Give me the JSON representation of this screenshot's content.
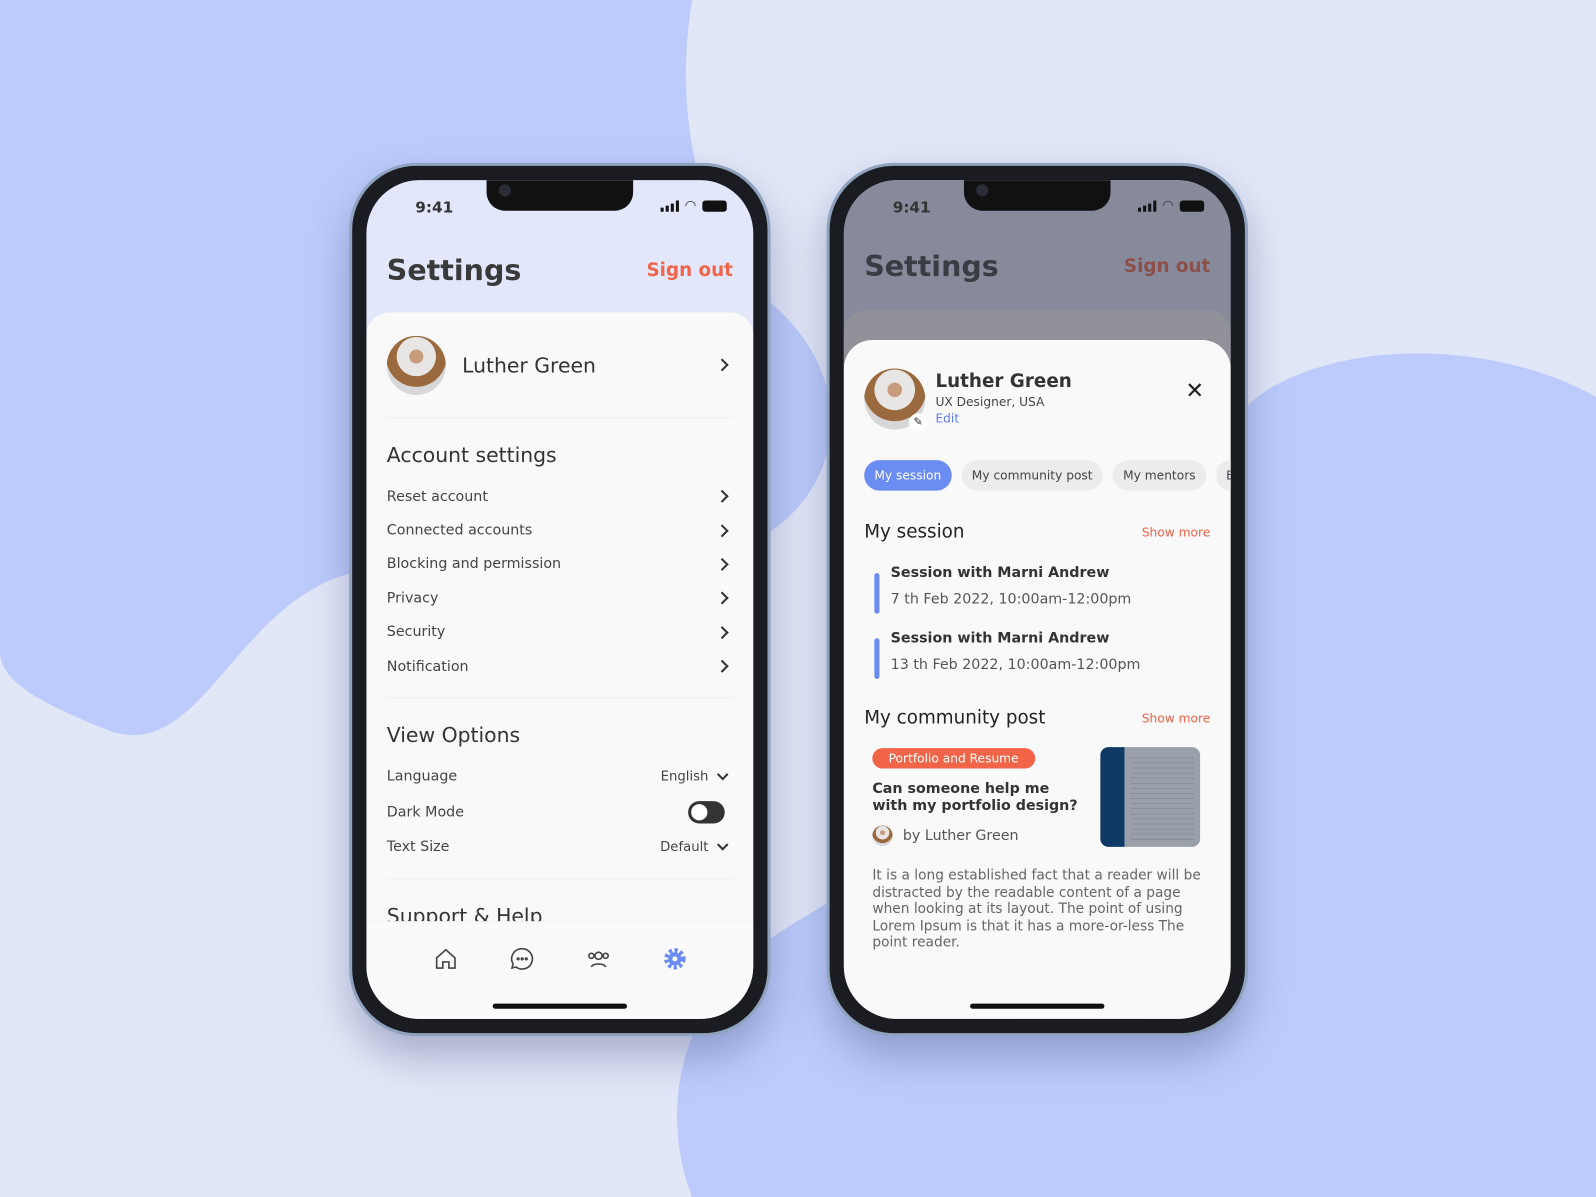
{
  "colors": {
    "accent": "#6b8cf2",
    "danger": "#f0644a",
    "background": "#e2e7f8",
    "blob": "#bccbfc"
  },
  "status": {
    "time": "9:41"
  },
  "settings": {
    "title": "Settings",
    "sign_out": "Sign out",
    "user": "Luther Green",
    "account_title": "Account settings",
    "account_items": [
      "Reset account",
      "Connected accounts",
      "Blocking and permission",
      "Privacy",
      "Security",
      "Notification"
    ],
    "view_title": "View Options",
    "language_label": "Language",
    "language_value": "English",
    "dark_mode_label": "Dark Mode",
    "dark_mode_on": false,
    "text_size_label": "Text Size",
    "text_size_value": "Default",
    "support_title": "Support & Help",
    "tabbar": [
      "home-icon",
      "chat-icon",
      "community-icon",
      "gear-icon"
    ],
    "active_tab": 3
  },
  "profile": {
    "name": "Luther Green",
    "subtitle": "UX Designer, USA",
    "edit": "Edit",
    "chips": [
      "My session",
      "My community post",
      "My mentors",
      "B"
    ],
    "session_title": "My session",
    "show_more": "Show more",
    "sessions": [
      {
        "title": "Session with Marni Andrew",
        "date": "7 th Feb 2022, 10:00am-12:00pm"
      },
      {
        "title": "Session with Marni Andrew",
        "date": "13 th Feb 2022, 10:00am-12:00pm"
      }
    ],
    "community_title": "My community post",
    "post": {
      "tag": "Portfolio and Resume",
      "question": "Can someone help me with my portfolio design?",
      "author": "by Luther Green",
      "body": "It is a long established fact that a reader will be distracted by the readable content of a page when looking at its layout. The point of using Lorem Ipsum is that it has a more-or-less The point reader."
    }
  }
}
